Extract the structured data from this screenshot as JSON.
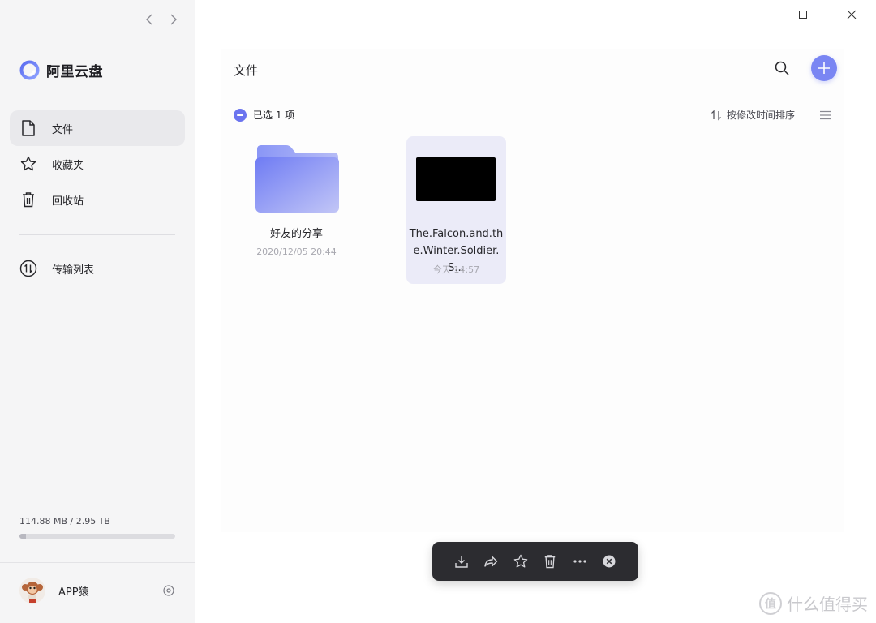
{
  "app": {
    "name": "阿里云盘"
  },
  "sidebar": {
    "items": [
      {
        "label": "文件",
        "icon": "file-icon",
        "active": true
      },
      {
        "label": "收藏夹",
        "icon": "star-icon",
        "active": false
      },
      {
        "label": "回收站",
        "icon": "trash-icon",
        "active": false
      }
    ],
    "transfer": {
      "label": "传输列表",
      "icon": "transfer-icon"
    },
    "storage": {
      "text": "114.88 MB / 2.95 TB",
      "used_fraction": 0.04
    },
    "user": {
      "name": "APP猿",
      "avatar_icon": "monkey-avatar-icon"
    }
  },
  "main": {
    "title": "文件",
    "selection_text": "已选 1 项",
    "sort_label": "按修改时间排序",
    "files": [
      {
        "name": "好友的分享",
        "date": "2020/12/05 20:44",
        "type": "folder",
        "selected": false
      },
      {
        "name": "The.Falcon.and.the.Winter.Soldier.S...",
        "date": "今天 14:57",
        "type": "video",
        "selected": true
      }
    ]
  },
  "action_bar": [
    "download-icon",
    "share-icon",
    "favorite-icon",
    "delete-icon",
    "more-icon",
    "close-icon"
  ],
  "watermark": {
    "text": "什么值得买",
    "logo_char": "值"
  },
  "colors": {
    "accent": "#7a86f3",
    "sidebar_bg": "#f5f5f6",
    "selected_card": "#ebebf8",
    "toolbar": "#2c2c30"
  }
}
